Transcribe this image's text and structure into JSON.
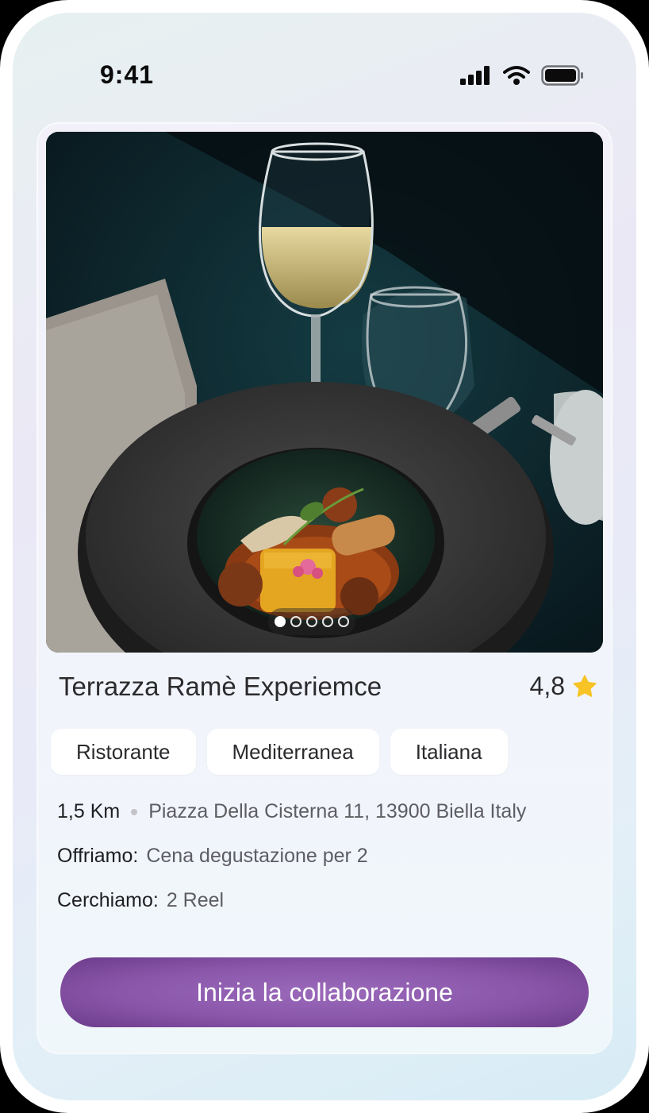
{
  "status_bar": {
    "time": "9:41"
  },
  "listing": {
    "title": "Terrazza Ramè Experiemce",
    "rating": "4,8",
    "tags": [
      "Ristorante",
      "Mediterranea",
      "Italiana"
    ],
    "distance": "1,5 Km",
    "address": "Piazza Della Cisterna 11, 13900 Biella Italy",
    "offer_label": "Offriamo:",
    "offer_value": "Cena degustazione per 2",
    "seek_label": "Cerchiamo:",
    "seek_value": "2 Reel",
    "carousel": {
      "total": 5,
      "active": 1
    }
  },
  "cta": {
    "label": "Inizia la collaborazione"
  },
  "colors": {
    "cta": "#8a56aa",
    "star": "#f7c325"
  }
}
